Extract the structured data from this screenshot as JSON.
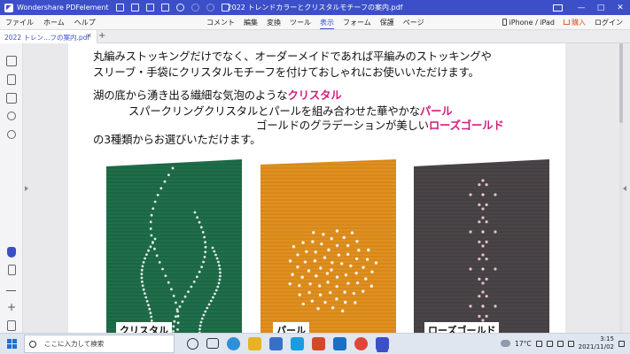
{
  "titlebar": {
    "app_name": "Wondershare PDFelement",
    "document_title": "2022 トレンドカラーとクリスタルモチーフの案内.pdf",
    "minimize": "—",
    "maximize": "□",
    "close": "✕"
  },
  "menubar": {
    "left": [
      "ファイル",
      "ホーム",
      "ヘルプ"
    ],
    "center": [
      "コメント",
      "編集",
      "変換",
      "ツール",
      "表示",
      "フォーム",
      "保護",
      "ページ"
    ],
    "active": "表示",
    "device": "iPhone / iPad",
    "buy": "購入",
    "login": "ログイン"
  },
  "tabs": {
    "active_label": "2022 トレン…フの案内.pdf",
    "close": "✕",
    "add": "+"
  },
  "content": {
    "line1": "丸編みストッキングだけでなく、オーダーメイドであれば平編みのストッキングや",
    "line2": "スリーブ・手袋にクリスタルモチーフを付けておしゃれにお使いいただけます。",
    "line3_prefix": "湖の底から湧き出る繊細な気泡のような",
    "line3_highlight": "クリスタル",
    "line4_prefix": "スパークリングクリスタルとパールを組み合わせた華やかな",
    "line4_highlight": "パール",
    "line5_prefix": "ゴールドのグラデーションが美しい",
    "line5_highlight": "ローズゴールド",
    "line6": "の3種類からお選びいただけます。",
    "highlight_color": "#d21d7a"
  },
  "photos": [
    {
      "label": "クリスタル",
      "color": "#1f6e4a"
    },
    {
      "label": "パール",
      "color": "#e0901f"
    },
    {
      "label": "ローズゴールド",
      "color": "#4a4448"
    }
  ],
  "taskbar": {
    "search_placeholder": "ここに入力して検索",
    "temperature": "17°C",
    "time": "3:15",
    "date": "2021/11/02"
  },
  "colors": {
    "brand": "#3c4fc9",
    "titlebar": "#3c4fc9"
  }
}
